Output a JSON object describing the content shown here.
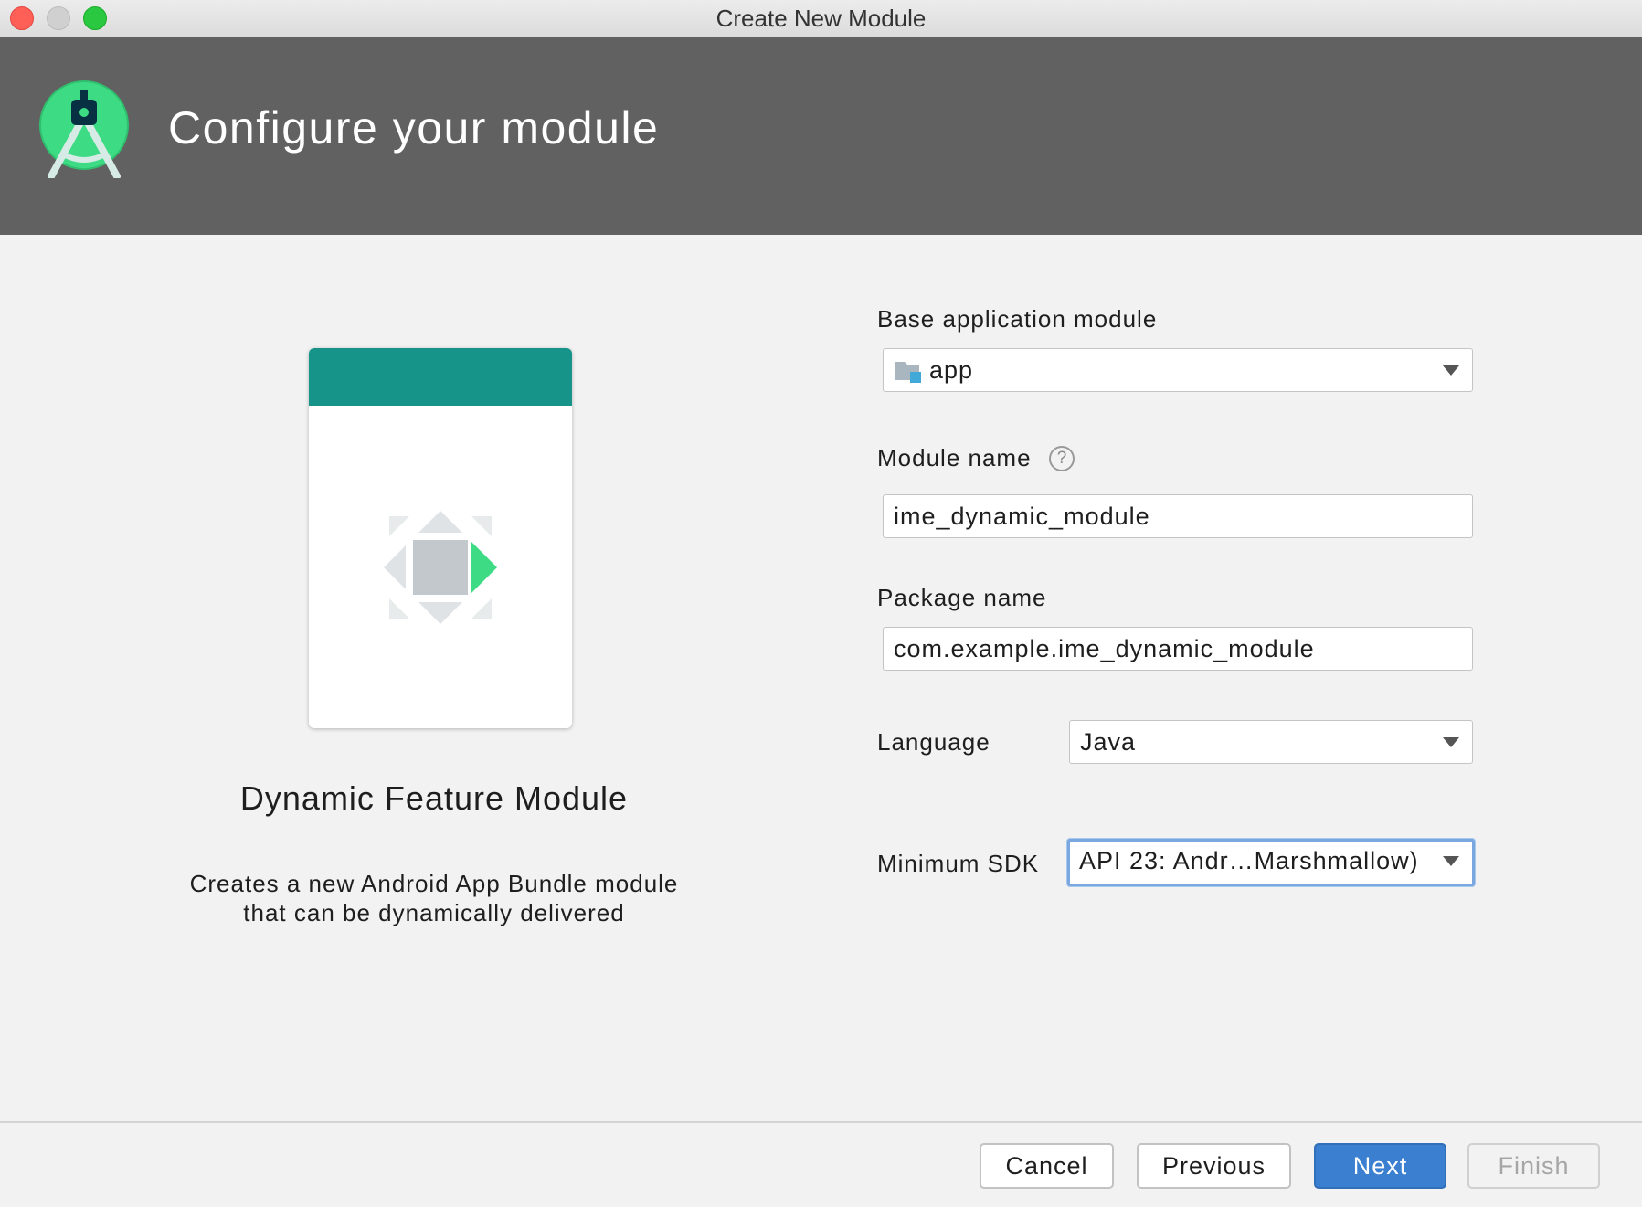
{
  "window": {
    "title": "Create New Module"
  },
  "header": {
    "title": "Configure your module",
    "logo": "android-studio-logo"
  },
  "template": {
    "name": "Dynamic Feature Module",
    "description": "Creates a new Android App Bundle module that can be dynamically delivered",
    "icon": "dynamic-feature-icon",
    "accent_color": "#17948a"
  },
  "form": {
    "base_module": {
      "label": "Base application module",
      "value": "app",
      "icon": "module-folder-icon"
    },
    "module_name": {
      "label": "Module name",
      "help": "?",
      "value": "ime_dynamic_module"
    },
    "package_name": {
      "label": "Package name",
      "value": "com.example.ime_dynamic_module"
    },
    "language": {
      "label": "Language",
      "value": "Java"
    },
    "min_sdk": {
      "label": "Minimum SDK",
      "value": "API 23: Andr…Marshmallow)"
    }
  },
  "buttons": {
    "cancel": "Cancel",
    "previous": "Previous",
    "next": "Next",
    "finish": "Finish"
  },
  "colors": {
    "header_bg": "#616161",
    "primary_button": "#3b7fd0",
    "focus_ring": "#7aa7e0"
  }
}
